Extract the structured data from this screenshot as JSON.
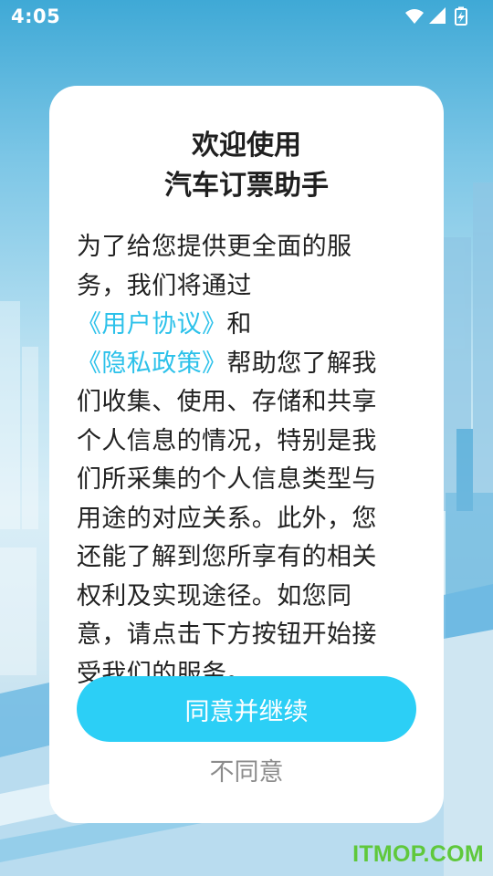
{
  "status_bar": {
    "time": "4:05",
    "icons": [
      "wifi-icon",
      "signal-icon",
      "battery-charging-icon"
    ]
  },
  "dialog": {
    "title_line1": "欢迎使用",
    "title_line2": "汽车订票助手",
    "body_segments": [
      {
        "text": "为了给您提供更全面的服务，我们将通过",
        "link": false
      },
      {
        "text": "《用户协议》",
        "link": true
      },
      {
        "text": "和",
        "link": false
      },
      {
        "text": "《隐私政策》",
        "link": true
      },
      {
        "text": "帮助您了解我们收集、使用、存储和共享个人信息的情况，特别是我们所采集的个人信息类型与用途的对应关系。此外，您还能了解到您所享有的相关权利及实现途径。如您同意，请点击下方按钮开始接受我们的服务。",
        "link": false
      }
    ],
    "agree_label": "同意并继续",
    "disagree_label": "不同意"
  },
  "watermark": "ITMOP.COM",
  "colors": {
    "accent": "#2ccff6",
    "link": "#2cc1ea",
    "watermark": "#5fc83b"
  }
}
